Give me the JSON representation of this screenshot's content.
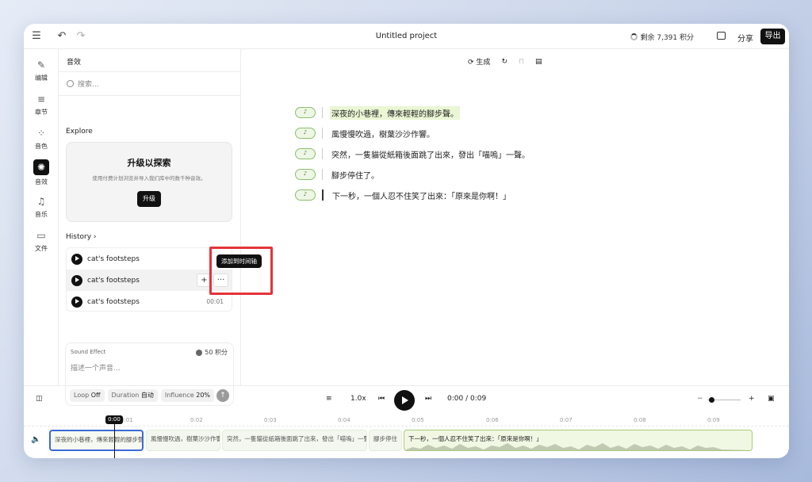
{
  "app": {
    "project_title": "Untitled project",
    "credits_text": "剩余 7,391 积分",
    "share_label": "分享",
    "export_label": "导出"
  },
  "rail": {
    "items": [
      {
        "label": "编辑",
        "icon": "pen-icon"
      },
      {
        "label": "章节",
        "icon": "list-icon"
      },
      {
        "label": "音色",
        "icon": "grid-icon"
      },
      {
        "label": "音效",
        "icon": "sparkle-icon",
        "active": true
      },
      {
        "label": "音乐",
        "icon": "music-icon"
      },
      {
        "label": "文件",
        "icon": "folder-icon"
      }
    ]
  },
  "panel": {
    "title": "音效",
    "search_placeholder": "搜索...",
    "explore_label": "Explore",
    "upgrade": {
      "title": "升级以探索",
      "desc": "使用付费计划浏览并导入我们库中的数千种音效。",
      "button": "升级"
    },
    "history_label": "History",
    "history": [
      {
        "name": "cat's footsteps",
        "duration": ""
      },
      {
        "name": "cat's footsteps",
        "duration": ""
      },
      {
        "name": "cat's footsteps",
        "duration": "00:01"
      }
    ],
    "tooltip": "添加到时间轴",
    "add_symbol": "+",
    "more_symbol": "···"
  },
  "sfx": {
    "label": "Sound Effect",
    "credits": "50 积分",
    "placeholder": "描述一个声音...",
    "loop_key": "Loop",
    "loop_val": "Off",
    "duration_key": "Duration",
    "duration_val": "自动",
    "influence_key": "Influence",
    "influence_val": "20%"
  },
  "toolbar": {
    "generate_label": "生成"
  },
  "editor": {
    "lines": [
      {
        "text": "深夜的小巷裡，傳來輕輕的腳步聲。",
        "highlight": true
      },
      {
        "text": "風慢慢吹過，樹葉沙沙作響。",
        "highlight": false
      },
      {
        "text": "突然，一隻貓從紙箱後面跳了出來，發出「喵嗚」一聲。",
        "highlight": false
      },
      {
        "text": "腳步停住了。",
        "highlight": false
      },
      {
        "text": "下一秒，一個人忍不住笑了出來：「原來是你啊！」",
        "highlight": false
      }
    ],
    "tag_symbol": "♪"
  },
  "transport": {
    "speed": "1.0x",
    "time": "0:00 / 0:09",
    "zoom_out": "−",
    "zoom_in": "+"
  },
  "timeline": {
    "playhead": "0:00",
    "ticks": [
      "0:01",
      "0:02",
      "0:03",
      "0:04",
      "0:05",
      "0:06",
      "0:07",
      "0:08",
      "0:09"
    ],
    "clips": [
      "深夜的小巷裡，傳來輕輕的腳步聲。",
      "風慢慢吹過，樹葉沙沙作響。",
      "突然，一隻貓從紙箱後面跳了出來，發出「喵嗚」一聲。",
      "腳步停住",
      "下一秒，一個人忍不住笑了出來：「原來是你啊！」"
    ]
  },
  "colors": {
    "highlight": "#eaf6d4",
    "accent_red": "#e5333a",
    "selection_blue": "#3a6bd6"
  }
}
